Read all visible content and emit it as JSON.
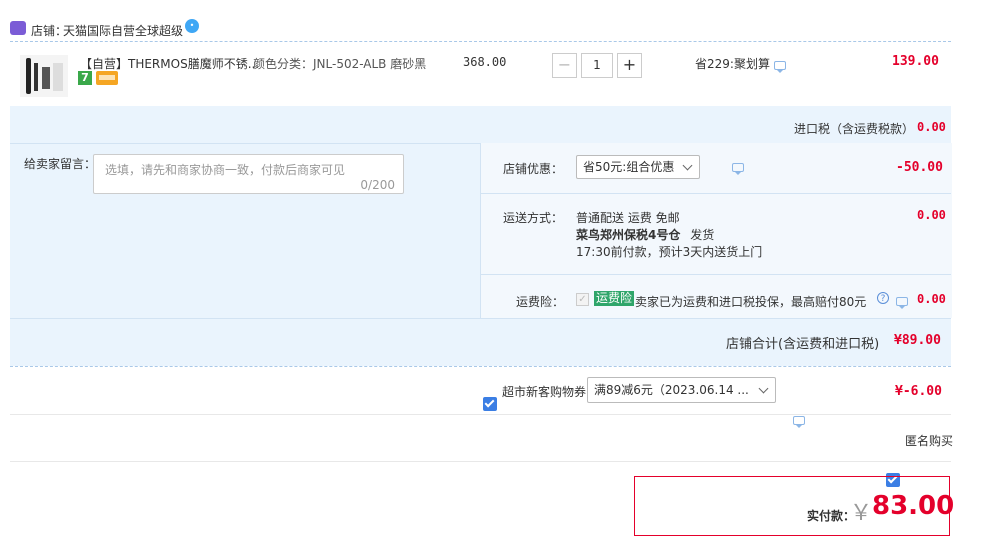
{
  "store": {
    "label": "店铺：",
    "name": "天猫国际自营全球超级"
  },
  "item": {
    "title": "【自营】THERMOS膳魔师不锈...",
    "sku": "颜色分类：JNL-502-ALB 磨砂黑",
    "unit_price": "368.00",
    "quantity": "1",
    "discount_note": "省229:聚划算",
    "subtotal": "139.00",
    "badge_seven": "7"
  },
  "import_tax": {
    "label": "进口税（含运费税款）",
    "value": "0.00"
  },
  "message": {
    "label": "给卖家留言：",
    "placeholder": "选填，请先和商家协商一致，付款后商家可见",
    "counter": "0/200"
  },
  "coupon": {
    "label": "店铺优惠：",
    "selected": "省50元:组合优惠",
    "value": "-50.00"
  },
  "shipping": {
    "label": "运送方式：",
    "line1": "普通配送 运费 免邮",
    "line2_bold": "菜鸟郑州保税4号仓",
    "line2_rest": "发货",
    "line3": "17:30前付款，预计3天内送货上门",
    "value": "0.00"
  },
  "insurance": {
    "label": "运费险：",
    "badge": "运费险",
    "text": "卖家已为运费和进口税投保，最高赔付80元",
    "value": "0.00"
  },
  "store_total": {
    "label": "店铺合计(含运费和进口税)",
    "value": "¥89.00"
  },
  "supermarket_coupon": {
    "label": "超市新客购物券",
    "selected": "满89减6元（2023.06.14 ...",
    "value": "¥-6.00"
  },
  "anonymous": {
    "label": "匿名购买"
  },
  "payment": {
    "label": "实付款：",
    "currency": "￥",
    "value": "83.00"
  }
}
